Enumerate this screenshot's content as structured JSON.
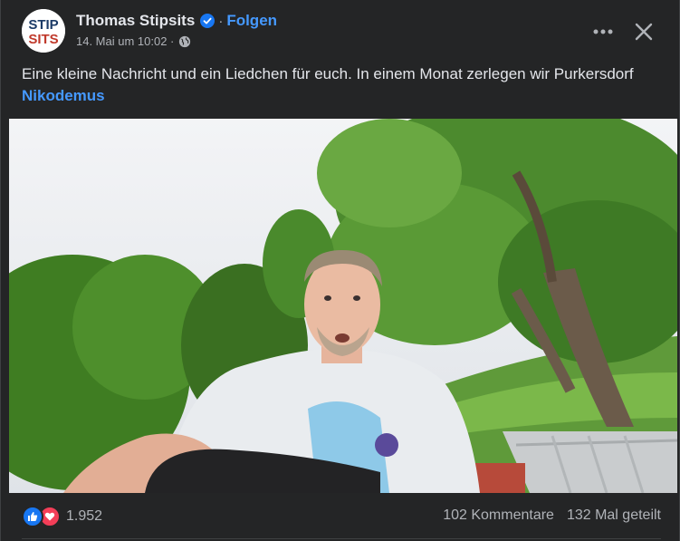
{
  "post": {
    "author": "Thomas Stipsits",
    "separator": "·",
    "follow_label": "Folgen",
    "timestamp": "14. Mai um 10:02 ·",
    "avatar_text_top": "STIP",
    "avatar_text_bottom": "SITS",
    "caption": "Eine kleine Nachricht und ein Liedchen für euch. In einem Monat zerlegen wir Purkersdorf",
    "caption_link": "Nikodemus"
  },
  "footer": {
    "reaction_count": "1.952",
    "comments": "102 Kommentare",
    "shares": "132 Mal geteilt"
  },
  "icons": {
    "verified": "verified-badge-icon",
    "privacy": "globe-icon",
    "more": "more-options-icon",
    "close": "close-icon",
    "like": "like-reaction-icon",
    "love": "love-reaction-icon"
  },
  "colors": {
    "background": "#242526",
    "link": "#4599ff",
    "like": "#1877f2",
    "love": "#f33e58"
  }
}
